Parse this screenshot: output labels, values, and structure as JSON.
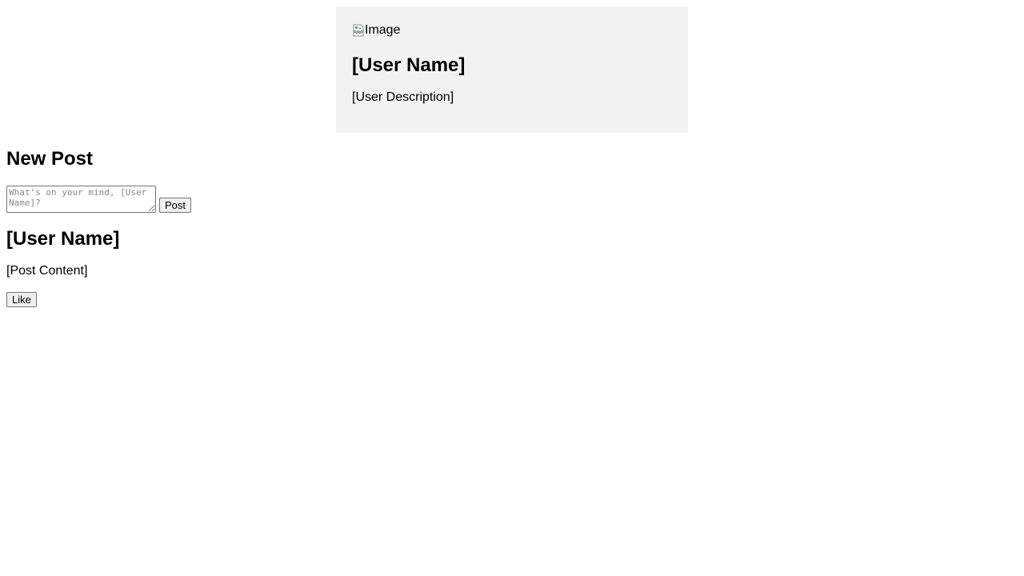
{
  "profile": {
    "image_alt": "Image",
    "user_name": "[User Name]",
    "user_description": "[User Description]"
  },
  "new_post": {
    "title": "New Post",
    "textarea_placeholder": "What's on your mind, [User Name]?",
    "submit_label": "Post"
  },
  "posts": [
    {
      "author": "[User Name]",
      "content": "[Post Content]",
      "like_label": "Like"
    }
  ],
  "icons": {
    "broken_image": "broken-image-icon"
  }
}
